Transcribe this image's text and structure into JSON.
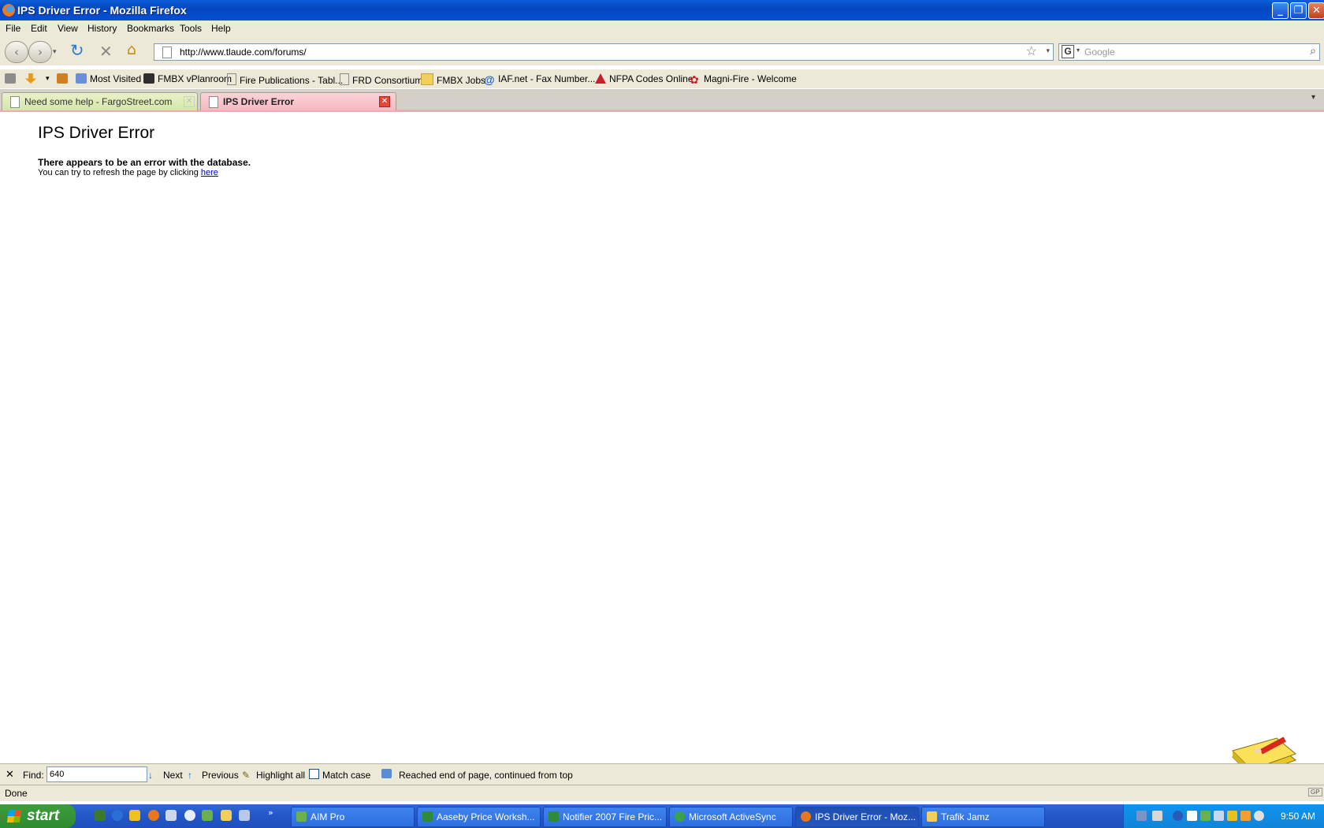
{
  "window": {
    "title": "IPS Driver Error - Mozilla Firefox"
  },
  "menu": [
    "File",
    "Edit",
    "View",
    "History",
    "Bookmarks",
    "Tools",
    "Help"
  ],
  "address": {
    "url": "http://www.tlaude.com/forums/"
  },
  "search": {
    "placeholder": "Google"
  },
  "bookmarks": [
    "Most Visited",
    "FMBX vPlanroom",
    "Fire Publications - Tabl...",
    "FRD Consortium",
    "FMBX Jobs",
    "IAF.net - Fax Number...",
    "NFPA Codes Online",
    "Magni-Fire - Welcome"
  ],
  "tabs": [
    {
      "label": "Need some help - FargoStreet.com",
      "active": false
    },
    {
      "label": "IPS Driver Error",
      "active": true
    }
  ],
  "page": {
    "heading": "IPS Driver Error",
    "message": "There appears to be an error with the database.",
    "hint_prefix": "You can try to refresh the page by clicking",
    "hint_link": "here"
  },
  "findbar": {
    "label": "Find:",
    "value": "640",
    "next": "Next",
    "previous": "Previous",
    "highlight": "Highlight all",
    "match_case": "Match case",
    "status": "Reached end of page, continued from top"
  },
  "status": {
    "text": "Done"
  },
  "taskbar": {
    "start": "start",
    "items": [
      {
        "label": "AIM Pro",
        "active": false
      },
      {
        "label": "Aaseby Price Worksh...",
        "active": false
      },
      {
        "label": "Notifier 2007 Fire Pric...",
        "active": false
      },
      {
        "label": "Microsoft ActiveSync",
        "active": false
      },
      {
        "label": "IPS Driver Error - Moz...",
        "active": true
      },
      {
        "label": "Trafik Jamz",
        "active": false
      }
    ],
    "clock": "9:50 AM"
  },
  "colors": {
    "xp_blue": "#0a5fd8",
    "tab_active": "#f6b8c0",
    "link": "#0000cc",
    "start_green": "#3c9f3c"
  }
}
